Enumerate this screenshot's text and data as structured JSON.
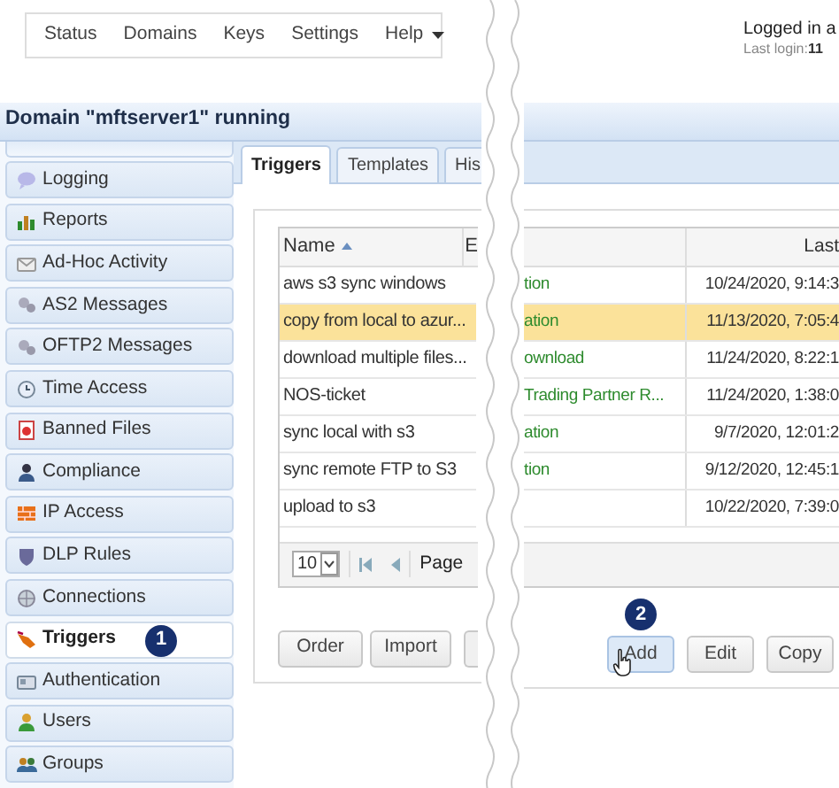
{
  "nav": {
    "items": [
      "Status",
      "Domains",
      "Keys",
      "Settings"
    ],
    "help": "Help"
  },
  "session": {
    "logged_in": "Logged in a",
    "last_login_label": "Last login:",
    "last_login_value": "11"
  },
  "domain_title": "Domain \"mftserver1\" running",
  "sidebar": [
    {
      "label": "Logging",
      "selected": false
    },
    {
      "label": "Reports",
      "selected": false
    },
    {
      "label": "Ad-Hoc Activity",
      "selected": false
    },
    {
      "label": "AS2 Messages",
      "selected": false
    },
    {
      "label": "OFTP2 Messages",
      "selected": false
    },
    {
      "label": "Time Access",
      "selected": false
    },
    {
      "label": "Banned Files",
      "selected": false
    },
    {
      "label": "Compliance",
      "selected": false
    },
    {
      "label": "IP Access",
      "selected": false
    },
    {
      "label": "DLP Rules",
      "selected": false
    },
    {
      "label": "Connections",
      "selected": false
    },
    {
      "label": "Triggers",
      "selected": true,
      "badge": "1"
    },
    {
      "label": "Authentication",
      "selected": false
    },
    {
      "label": "Users",
      "selected": false
    },
    {
      "label": "Groups",
      "selected": false
    }
  ],
  "tabs": [
    {
      "label": "Triggers",
      "selected": true
    },
    {
      "label": "Templates",
      "selected": false
    },
    {
      "label": "His",
      "selected": false
    }
  ],
  "table": {
    "columns": [
      "Name",
      "E",
      "Last"
    ],
    "rows": [
      {
        "name": "aws s3 sync windows",
        "event": "tion",
        "last": "10/24/2020, 9:14:3",
        "selected": false
      },
      {
        "name": "copy from local to azur...",
        "event": "ation",
        "last": "11/13/2020, 7:05:4",
        "selected": true
      },
      {
        "name": "download multiple files...",
        "event": "ownload",
        "last": "11/24/2020, 8:22:1",
        "selected": false
      },
      {
        "name": "NOS-ticket",
        "event": "Trading Partner R...",
        "last": "11/24/2020, 1:38:0",
        "selected": false
      },
      {
        "name": "sync local with s3",
        "event": "ation",
        "last": "9/7/2020, 12:01:2",
        "selected": false
      },
      {
        "name": "sync remote FTP to S3",
        "event": "tion",
        "last": "9/12/2020, 12:45:1",
        "selected": false
      },
      {
        "name": "upload to s3",
        "last": "10/22/2020, 7:39:0",
        "selected": false
      }
    ]
  },
  "pager": {
    "page_size": "10",
    "page_label": "Page"
  },
  "buttons_left": [
    "Order",
    "Import"
  ],
  "buttons_right": [
    {
      "label": "Add",
      "hovered": true,
      "badge": "2"
    },
    {
      "label": "Edit",
      "hovered": false
    },
    {
      "label": "Copy",
      "hovered": false
    }
  ]
}
